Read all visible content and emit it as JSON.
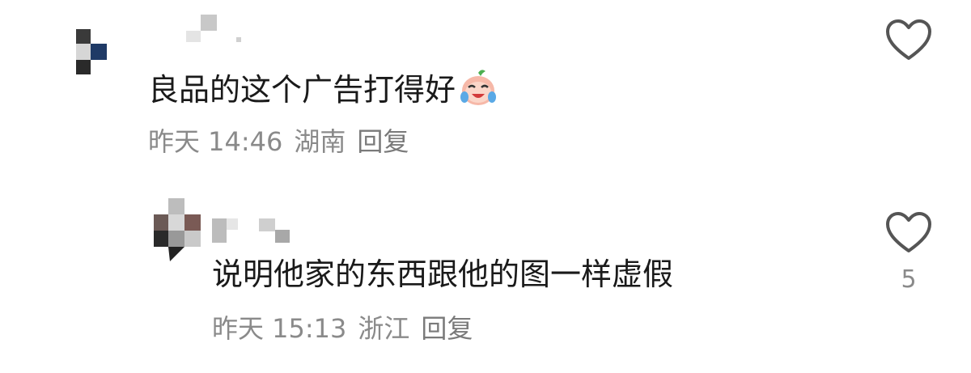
{
  "comments": [
    {
      "text": "良品的这个广告打得好",
      "emoji": "crying-laughing-face-icon",
      "time": "昨天 14:46",
      "location": "湖南",
      "reply_label": "回复",
      "likes": ""
    },
    {
      "text": "说明他家的东西跟他的图一样虚假",
      "time": "昨天 15:13",
      "location": "浙江",
      "reply_label": "回复",
      "likes": "5"
    }
  ],
  "colors": {
    "text": "#1a1a1a",
    "meta": "#8a8a8a",
    "heart_stroke": "#555555"
  }
}
